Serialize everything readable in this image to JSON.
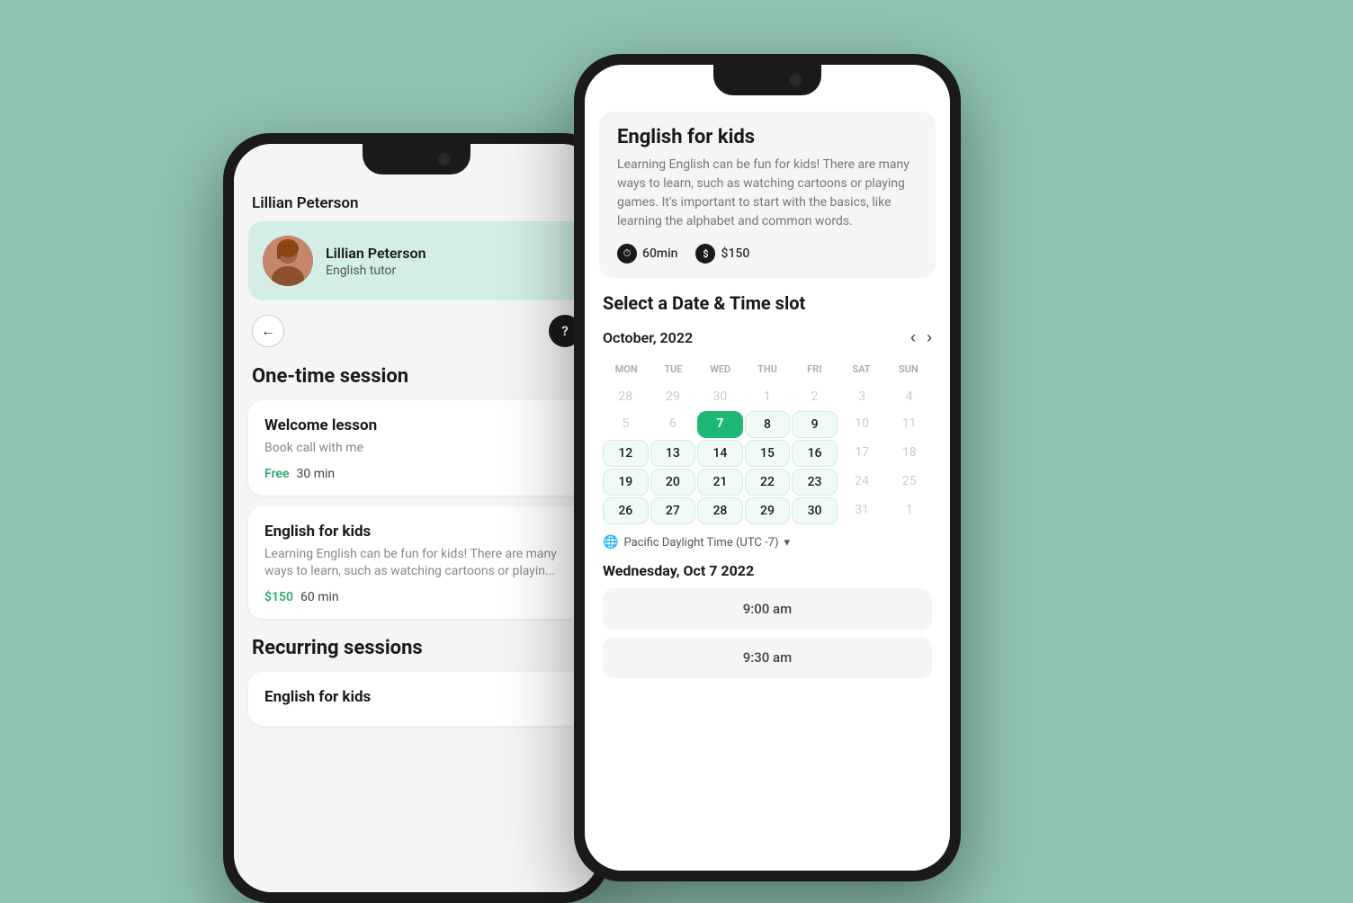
{
  "background": "#8fc4b0",
  "phone1": {
    "header_name": "Lillian Peterson",
    "tutor_card": {
      "name": "Lillian Peterson",
      "role": "English tutor"
    },
    "section_one_time": "One-time session",
    "cards": [
      {
        "title": "Welcome lesson",
        "desc": "Book call with me",
        "price_label": "Free",
        "duration": "30 min"
      },
      {
        "title": "English for kids",
        "desc": "Learning English can be fun for kids! There are many ways to learn, such as watching cartoons or playin...",
        "price_label": "$150",
        "duration": "60 min"
      }
    ],
    "section_recurring": "Recurring sessions",
    "recurring_card": {
      "title": "English for kids"
    }
  },
  "phone2": {
    "lesson_title": "English for kids",
    "lesson_desc": "Learning English can be fun for kids! There are many ways to learn, such as watching cartoons or playing games. It's important to start with the basics, like learning the alphabet and common words.",
    "duration": "60min",
    "price": "$150",
    "calendar_section_title": "Select a Date & Time slot",
    "month_label": "October, 2022",
    "day_headers": [
      "MON",
      "TUE",
      "WED",
      "THU",
      "FRI",
      "SAT",
      "SUN"
    ],
    "weeks": [
      [
        {
          "day": "28",
          "state": "gray"
        },
        {
          "day": "29",
          "state": "gray"
        },
        {
          "day": "30",
          "state": "gray"
        },
        {
          "day": "1",
          "state": "gray"
        },
        {
          "day": "2",
          "state": "gray"
        },
        {
          "day": "3",
          "state": "gray"
        },
        {
          "day": "4",
          "state": "gray"
        }
      ],
      [
        {
          "day": "5",
          "state": "gray"
        },
        {
          "day": "6",
          "state": "gray"
        },
        {
          "day": "7",
          "state": "selected"
        },
        {
          "day": "8",
          "state": "available"
        },
        {
          "day": "9",
          "state": "available"
        },
        {
          "day": "10",
          "state": "gray"
        },
        {
          "day": "11",
          "state": "gray"
        }
      ],
      [
        {
          "day": "12",
          "state": "available"
        },
        {
          "day": "13",
          "state": "available"
        },
        {
          "day": "14",
          "state": "available"
        },
        {
          "day": "15",
          "state": "available"
        },
        {
          "day": "16",
          "state": "available"
        },
        {
          "day": "17",
          "state": "gray"
        },
        {
          "day": "18",
          "state": "gray"
        }
      ],
      [
        {
          "day": "19",
          "state": "available"
        },
        {
          "day": "20",
          "state": "available"
        },
        {
          "day": "21",
          "state": "available"
        },
        {
          "day": "22",
          "state": "available"
        },
        {
          "day": "23",
          "state": "available"
        },
        {
          "day": "24",
          "state": "gray"
        },
        {
          "day": "25",
          "state": "gray"
        }
      ],
      [
        {
          "day": "26",
          "state": "available"
        },
        {
          "day": "27",
          "state": "available"
        },
        {
          "day": "28",
          "state": "available"
        },
        {
          "day": "29",
          "state": "available"
        },
        {
          "day": "30",
          "state": "available"
        },
        {
          "day": "31",
          "state": "gray"
        },
        {
          "day": "1",
          "state": "gray"
        }
      ]
    ],
    "timezone_label": "Pacific Daylight Time (UTC -7)",
    "selected_date_label": "Wednesday, Oct 7 2022",
    "time_slots": [
      "9:00 am",
      "9:30 am"
    ]
  }
}
